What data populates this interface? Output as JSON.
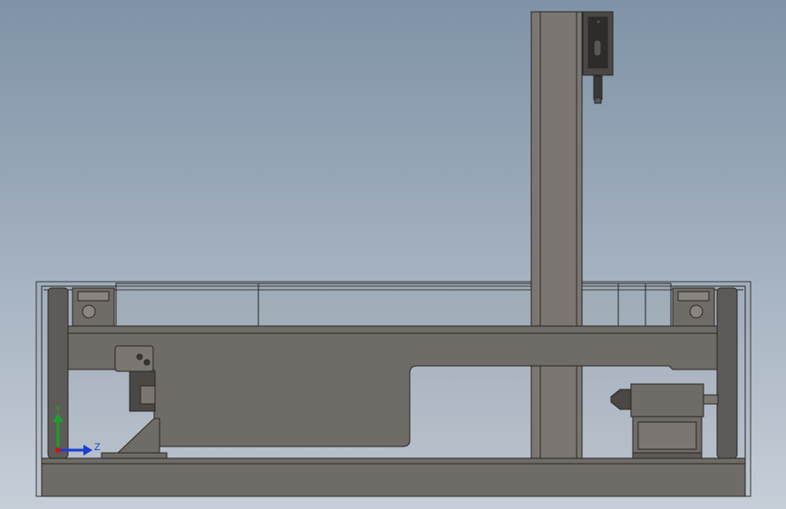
{
  "viewport": {
    "background_top": "#7f92a7",
    "background_bottom": "#c6ced8",
    "view_orientation": "side view"
  },
  "triad": {
    "y_label": "Y",
    "z_label": "Z",
    "y_color": "#1a9f2a",
    "z_color": "#1a3fd0",
    "origin_color": "#c01818"
  },
  "model": {
    "frame_color": "#6f6b67",
    "steel_color": "#7b7671",
    "dark_color": "#3f3d3b",
    "outline_color": "#2a2826"
  }
}
